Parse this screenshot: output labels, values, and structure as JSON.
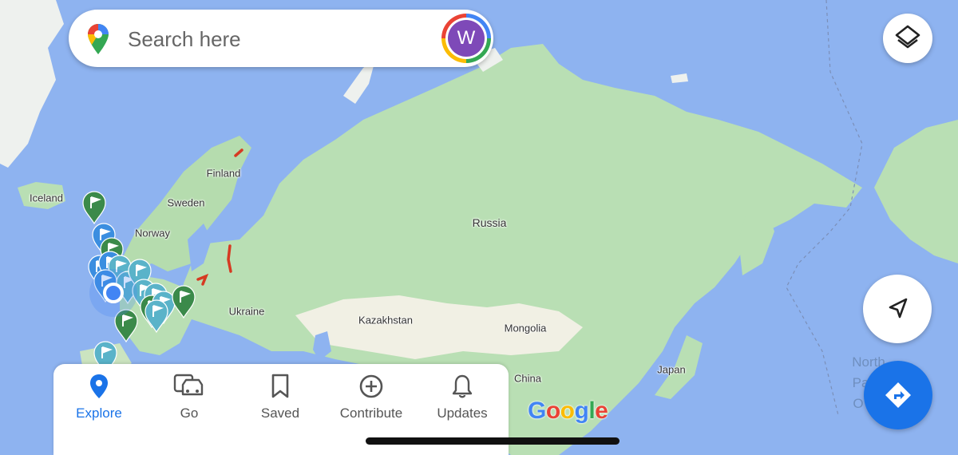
{
  "map": {
    "country_labels": [
      {
        "name": "Iceland"
      },
      {
        "name": "Finland"
      },
      {
        "name": "Sweden"
      },
      {
        "name": "Norway"
      },
      {
        "name": "Russia"
      },
      {
        "name": "Ukraine"
      },
      {
        "name": "Kazakhstan"
      },
      {
        "name": "Mongolia"
      },
      {
        "name": "China"
      },
      {
        "name": "Japan"
      }
    ],
    "ocean_label_fragments": [
      "North",
      "Pa",
      "O"
    ],
    "colors": {
      "water": "#8eb3f0",
      "land": "#b9dfb4",
      "forest": "#a5d49e",
      "arid": "#f1f0e4",
      "ice": "#f4f6f4",
      "pin_green": "#3b8a4a",
      "pin_blue": "#3b8ee0",
      "pin_teal": "#5ab3c9",
      "route_red": "#d63a22"
    }
  },
  "search": {
    "placeholder": "Search here",
    "avatar_letter": "W"
  },
  "icons": {
    "pin": "google-maps-pin-icon",
    "mic": "mic-icon",
    "layers": "layers-icon",
    "locate": "navigation-arrow-icon",
    "directions": "directions-icon"
  },
  "tabs": [
    {
      "label": "Explore",
      "icon": "explore-pin-icon",
      "active": true
    },
    {
      "label": "Go",
      "icon": "car-transit-icon",
      "active": false
    },
    {
      "label": "Saved",
      "icon": "bookmark-icon",
      "active": false
    },
    {
      "label": "Contribute",
      "icon": "add-circle-icon",
      "active": false
    },
    {
      "label": "Updates",
      "icon": "bell-icon",
      "active": false
    }
  ],
  "watermark": "Google"
}
